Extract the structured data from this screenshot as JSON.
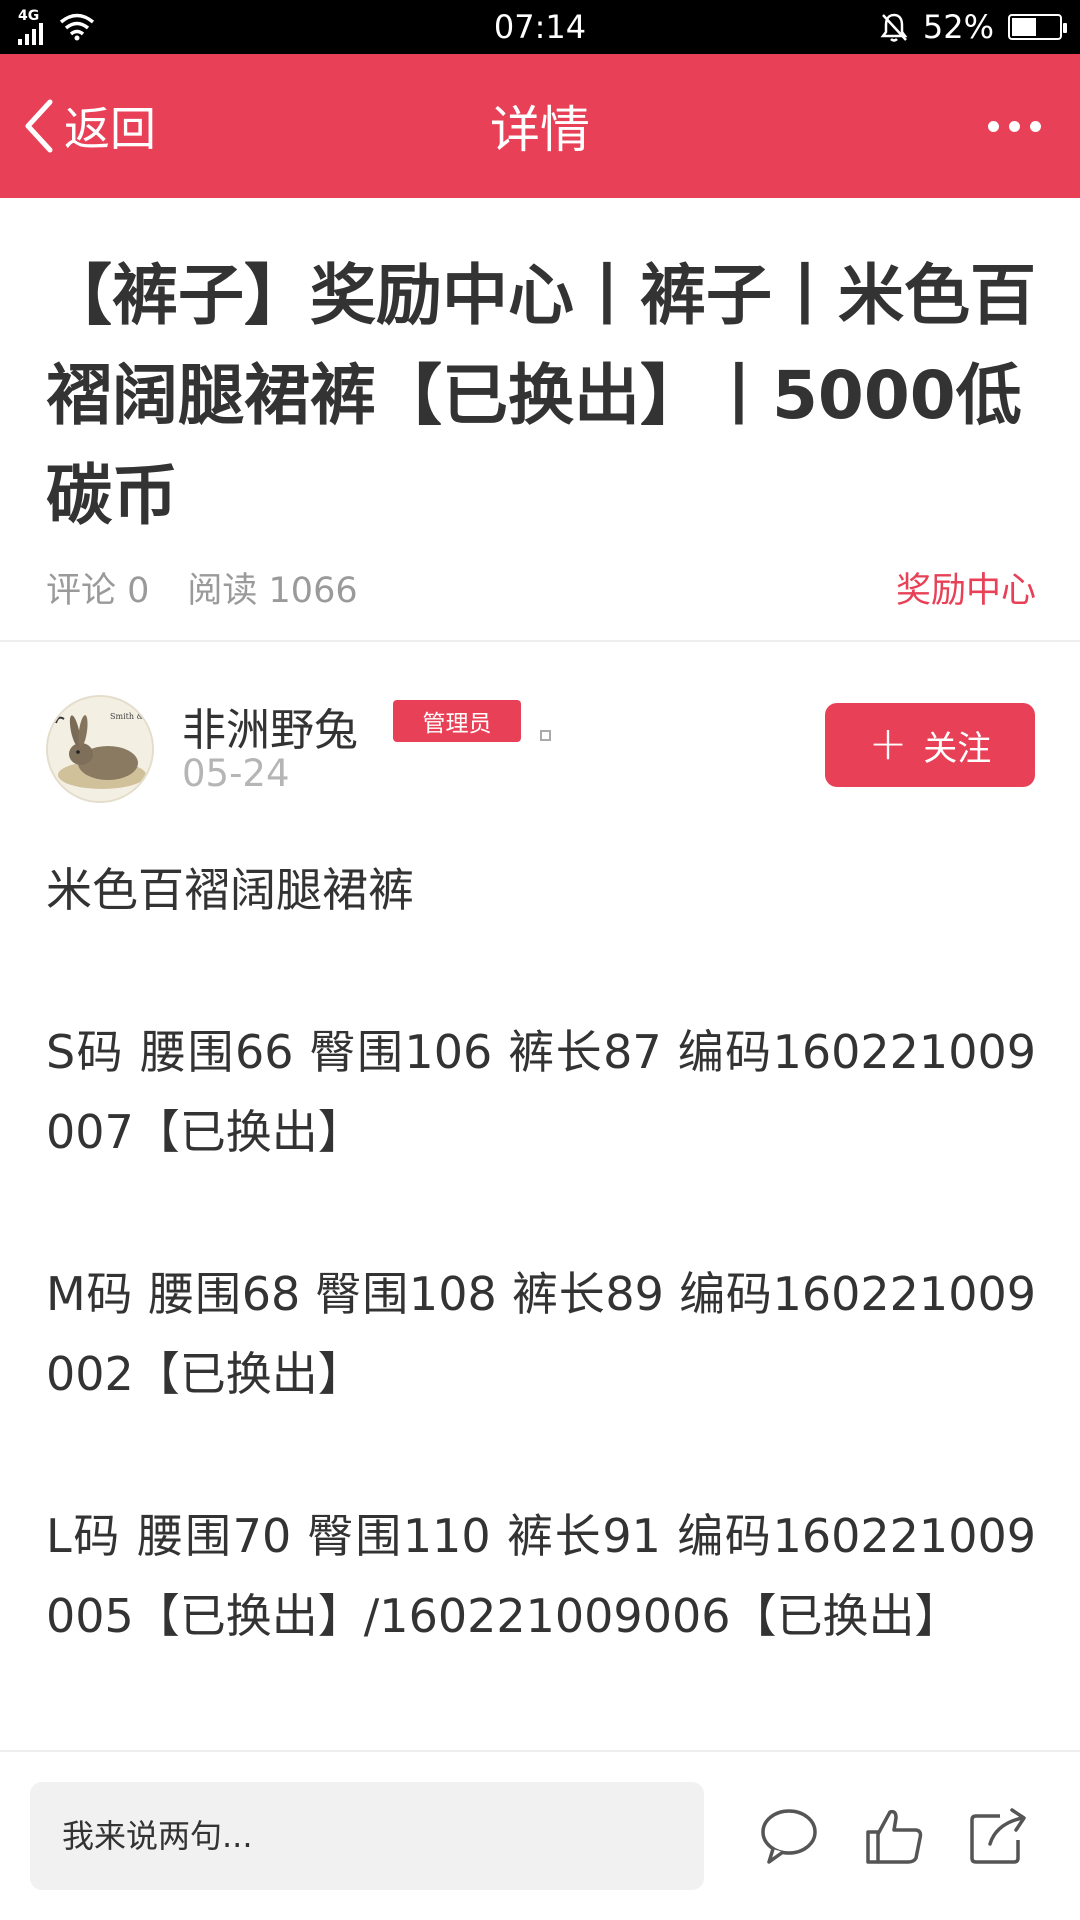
{
  "status_bar": {
    "network": "4G",
    "time": "07:14",
    "battery": "52%",
    "battery_level": 0.52
  },
  "header": {
    "back_label": "返回",
    "title": "详情"
  },
  "article": {
    "title": "【裤子】奖励中心丨裤子丨米色百褶阔腿裙裤【已换出】丨5000低碳币",
    "comments_label": "评论 0",
    "reads_label": "阅读 1066",
    "category": "奖励中心"
  },
  "author": {
    "name": "非洲野兔",
    "badge": "管理员",
    "date": "05-24",
    "follow_label": "关注"
  },
  "content": {
    "paragraphs": [
      "米色百褶阔腿裙裤",
      "S码 腰围66 臀围106 裤长87 编码160221009007【已换出】",
      "M码 腰围68 臀围108 裤长89 编码160221009002【已换出】",
      "L码 腰围70 臀围110 裤长91 编码160221009005【已换出】/160221009006【已换出】"
    ]
  },
  "bottom_bar": {
    "comment_placeholder": "我来说两句..."
  },
  "colors": {
    "accent": "#e84056",
    "status_bar": "#000000",
    "meta_text": "#9a9a9a"
  }
}
